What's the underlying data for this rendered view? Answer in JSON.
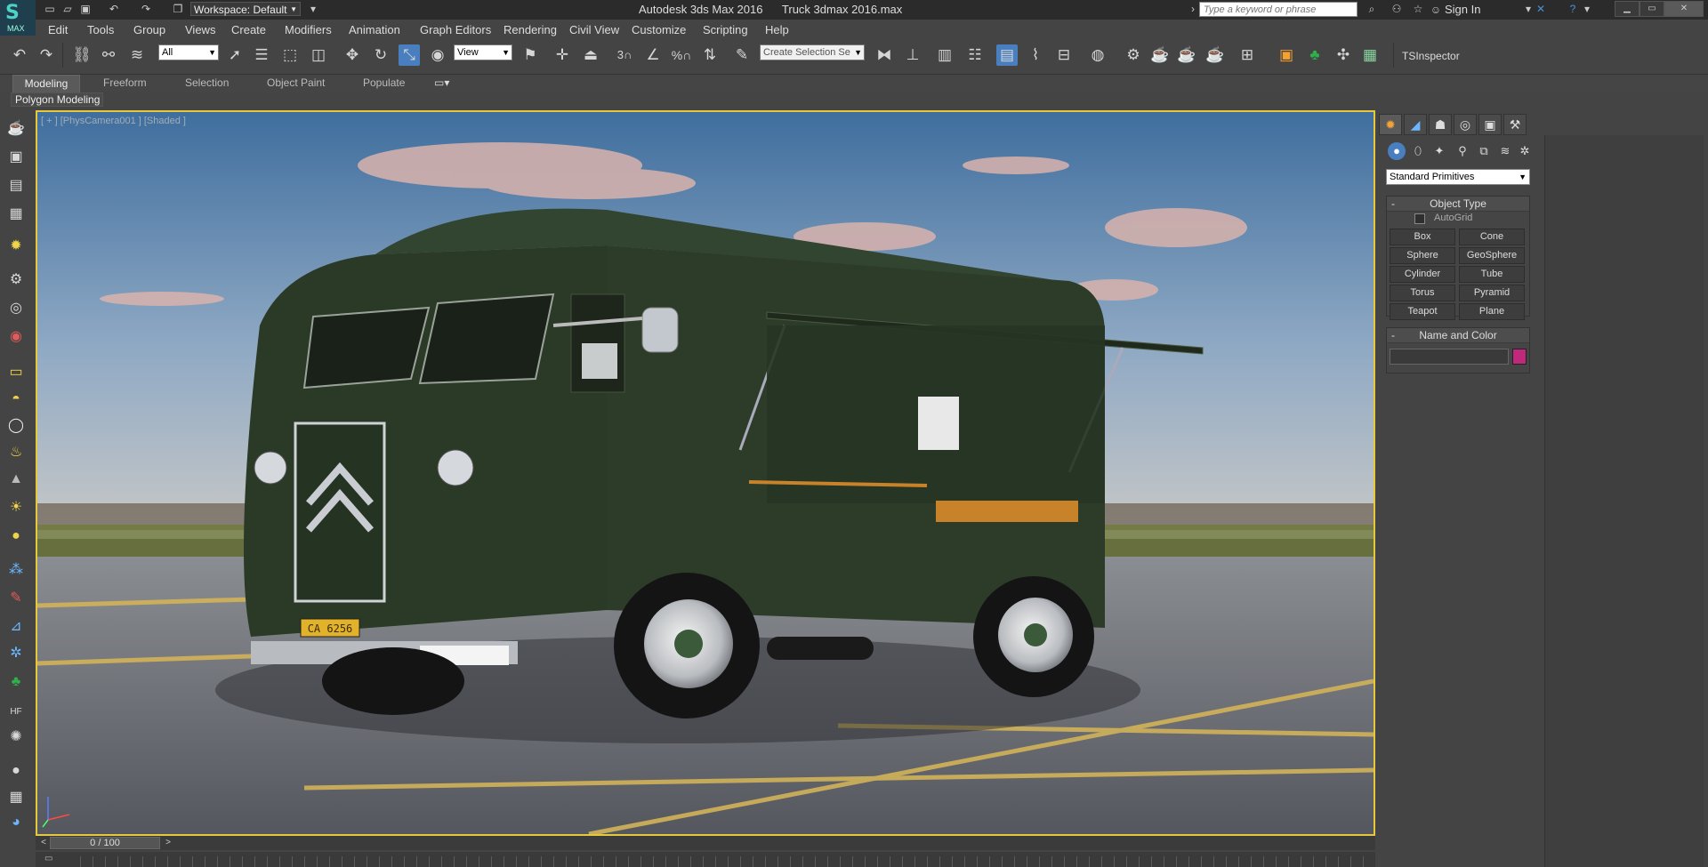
{
  "titlebar": {
    "logo_text": "MAX",
    "workspace": "Workspace: Default",
    "title": "Autodesk 3ds Max 2016      Truck 3dmax 2016.max",
    "search_placeholder": "Type a keyword or phrase",
    "sign_in": "Sign In"
  },
  "menus": [
    "Edit",
    "Tools",
    "Group",
    "Views",
    "Create",
    "Modifiers",
    "Animation",
    "Graph Editors",
    "Rendering",
    "Civil View",
    "Customize",
    "Scripting",
    "Help"
  ],
  "toolbar": {
    "selection_filter": "All",
    "ref_coord": "View",
    "named_selection": "Create Selection Se",
    "snap_3": "3",
    "snap_percent": "%",
    "ts_inspector": "TSInspector"
  },
  "ribbon": {
    "tabs": [
      "Modeling",
      "Freeform",
      "Selection",
      "Object Paint",
      "Populate"
    ],
    "active_tab": "Modeling",
    "panel": "Polygon Modeling"
  },
  "viewport": {
    "label": "[ + ] [PhysCamera001 ] [Shaded ]",
    "license_plate": "CA 6256",
    "colors": {
      "sky_top": "#3f6e9e",
      "sky_bottom": "#c9c9c7",
      "tarmac": "#6d6f76",
      "truck_body": "#2a3a26",
      "accent": "#e6c93a"
    }
  },
  "command_panel": {
    "dropdown": "Standard Primitives",
    "object_type_title": "Object Type",
    "autogrid": "AutoGrid",
    "buttons": [
      "Box",
      "Cone",
      "Sphere",
      "GeoSphere",
      "Cylinder",
      "Tube",
      "Torus",
      "Pyramid",
      "Teapot",
      "Plane"
    ],
    "name_color_title": "Name and Color",
    "swatch_color": "#c0287c"
  },
  "timeline": {
    "frame": "0 / 100"
  }
}
